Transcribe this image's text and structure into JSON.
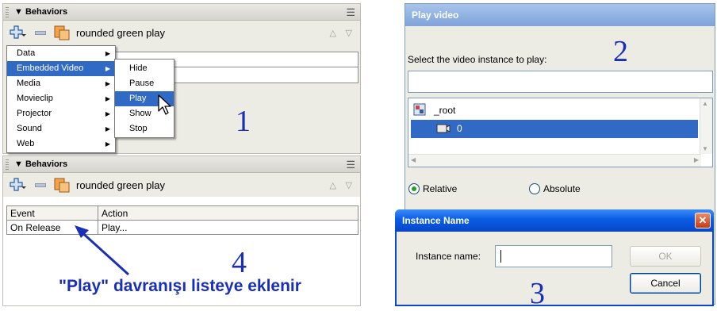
{
  "behaviors_top": {
    "title": "Behaviors",
    "symbol_name": "rounded green play",
    "menu": [
      {
        "label": "Data"
      },
      {
        "label": "Embedded Video",
        "selected": true
      },
      {
        "label": "Media"
      },
      {
        "label": "Movieclip"
      },
      {
        "label": "Projector"
      },
      {
        "label": "Sound"
      },
      {
        "label": "Web"
      }
    ],
    "submenu": [
      {
        "label": "Hide"
      },
      {
        "label": "Pause"
      },
      {
        "label": "Play",
        "selected": true
      },
      {
        "label": "Show"
      },
      {
        "label": "Stop"
      }
    ],
    "annotation": "1"
  },
  "behaviors_bottom": {
    "title": "Behaviors",
    "symbol_name": "rounded green play",
    "columns": [
      "Event",
      "Action"
    ],
    "rows": [
      [
        "On Release",
        "Play..."
      ]
    ],
    "annotation": "4",
    "caption": "\"Play\" davranışı listeye eklenir"
  },
  "play_video_dialog": {
    "title": "Play video",
    "prompt": "Select the video instance to play:",
    "annotation": "2",
    "tree": [
      {
        "label": "_root"
      },
      {
        "label": "0",
        "selected": true
      }
    ],
    "radio_relative": "Relative",
    "radio_absolute": "Absolute"
  },
  "instance_dialog": {
    "title": "Instance Name",
    "field_label": "Instance name:",
    "ok_label": "OK",
    "cancel_label": "Cancel",
    "annotation": "3"
  },
  "colors": {
    "annotation_blue": "#1a2fb8",
    "selection_blue": "#316ac5",
    "panel_bg": "#ecebe4"
  }
}
